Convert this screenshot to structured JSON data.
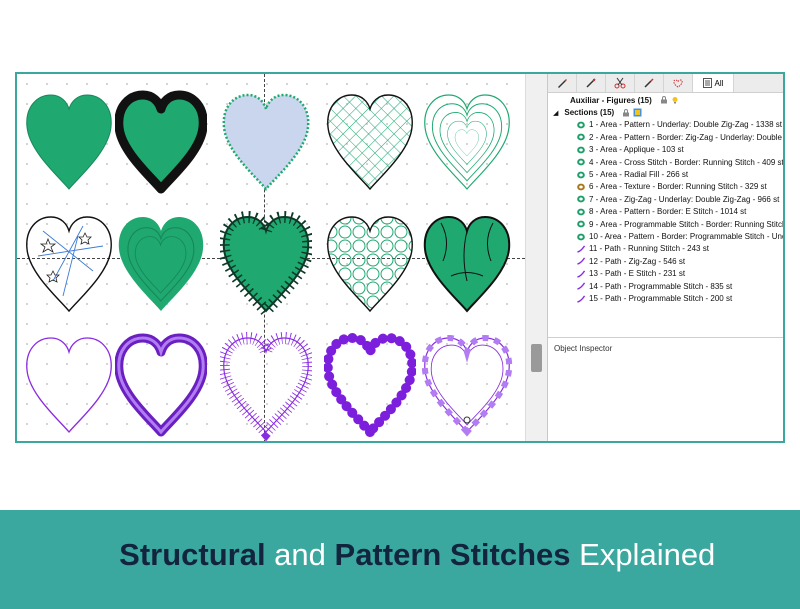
{
  "tabs": [
    "All"
  ],
  "tree": {
    "auxiliary": "Auxiliar - Figures (15)",
    "sections": "Sections (15)",
    "items": [
      {
        "label": "1 - Area - Pattern - Underlay: Double Zig-Zag - 1338 st",
        "color": "#1c9e68",
        "kind": "area"
      },
      {
        "label": "2 - Area - Pattern - Border: Zig-Zag - Underlay: Double Zi",
        "color": "#1c9e68",
        "kind": "area"
      },
      {
        "label": "3 - Area - Applique - 103 st",
        "color": "#1c9e68",
        "kind": "area"
      },
      {
        "label": "4 - Area - Cross Stitch - Border: Running Stitch - 409 st",
        "color": "#1c9e68",
        "kind": "area"
      },
      {
        "label": "5 - Area - Radial Fill - 266 st",
        "color": "#1c9e68",
        "kind": "area"
      },
      {
        "label": "6 - Area - Texture - Border: Running Stitch - 329 st",
        "color": "#a8761c",
        "kind": "area"
      },
      {
        "label": "7 - Area - Zig-Zag - Underlay: Double Zig-Zag - 966 st",
        "color": "#1c9e68",
        "kind": "area"
      },
      {
        "label": "8 - Area - Pattern - Border: E Stitch - 1014 st",
        "color": "#1c9e68",
        "kind": "area"
      },
      {
        "label": "9 - Area - Programmable Stitch - Border: Running Stitch",
        "color": "#1c9e68",
        "kind": "area"
      },
      {
        "label": "10 - Area - Pattern - Border: Programmable Stitch - Under",
        "color": "#1c9e68",
        "kind": "area"
      },
      {
        "label": "11 - Path - Running Stitch - 243 st",
        "color": "#8a2be2",
        "kind": "path"
      },
      {
        "label": "12 - Path - Zig-Zag - 546 st",
        "color": "#8a2be2",
        "kind": "path"
      },
      {
        "label": "13 - Path - E Stitch - 231 st",
        "color": "#8a2be2",
        "kind": "path"
      },
      {
        "label": "14 - Path - Programmable Stitch - 835 st",
        "color": "#8a2be2",
        "kind": "path"
      },
      {
        "label": "15 - Path - Programmable Stitch - 200 st",
        "color": "#8a2be2",
        "kind": "path"
      }
    ]
  },
  "inspector": {
    "title": "Object Inspector"
  },
  "footer": {
    "word1": "Structural",
    "word2": " and ",
    "word3": "Pattern Stitches",
    "word4": " Explained"
  },
  "colors": {
    "accent": "#3aa89f",
    "green": "#1fa971",
    "purple": "#8a2be2",
    "navy": "#13243f"
  },
  "hearts": [
    {
      "name": "heart-pattern-fill",
      "fill": "#1fa971"
    },
    {
      "name": "heart-zigzag-border",
      "fill": "#1fa971"
    },
    {
      "name": "heart-applique",
      "fill": "#b9cbe8"
    },
    {
      "name": "heart-cross-stitch",
      "fill": "none"
    },
    {
      "name": "heart-radial-fill",
      "fill": "none"
    },
    {
      "name": "heart-texture",
      "fill": "none"
    },
    {
      "name": "heart-zigzag-underlay",
      "fill": "#1fa971"
    },
    {
      "name": "heart-e-stitch-border",
      "fill": "#1fa971"
    },
    {
      "name": "heart-programmable-stitch",
      "fill": "none"
    },
    {
      "name": "heart-pattern-programmable-border",
      "fill": "#1fa971"
    },
    {
      "name": "heart-path-running-stitch",
      "fill": "none"
    },
    {
      "name": "heart-path-zigzag",
      "fill": "none"
    },
    {
      "name": "heart-path-e-stitch",
      "fill": "none"
    },
    {
      "name": "heart-path-programmable-beads",
      "fill": "none"
    },
    {
      "name": "heart-path-programmable-lace",
      "fill": "none"
    }
  ]
}
